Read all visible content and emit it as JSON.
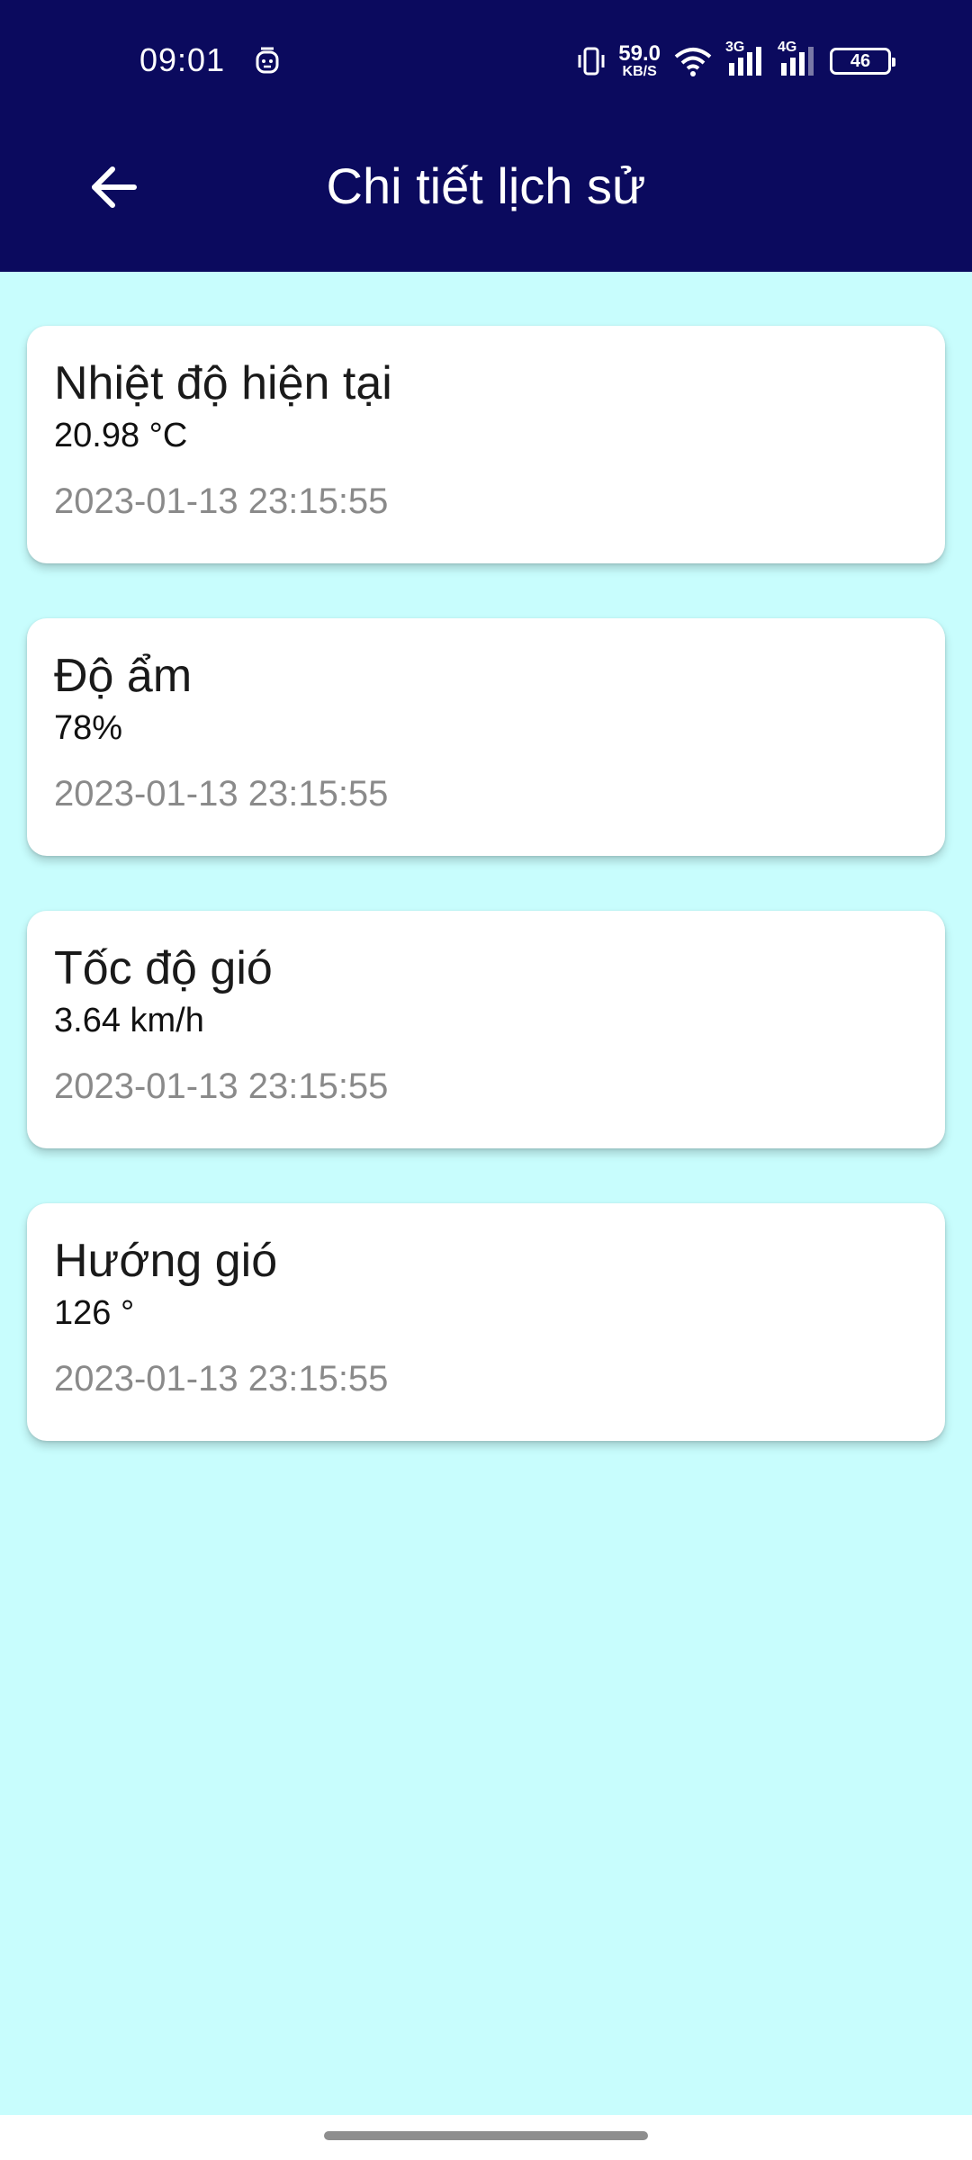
{
  "status_bar": {
    "time": "09:01",
    "net_speed_value": "59.0",
    "net_speed_unit": "KB/S",
    "signal_1_label": "3G",
    "signal_2_label": "4G",
    "battery": "46",
    "icons": [
      "face-icon",
      "vibrate-icon",
      "wifi-icon",
      "signal-3g-icon",
      "signal-4g-icon",
      "battery-icon"
    ]
  },
  "toolbar": {
    "title": "Chi tiết lịch sử",
    "back_icon": "arrow-left-icon"
  },
  "colors": {
    "app_bar": "#0b0a5e",
    "background": "#c8fdfd",
    "card": "#ffffff",
    "timestamp": "#8a8a8a"
  },
  "records": [
    {
      "label": "Nhiệt độ hiện tại",
      "value": "20.98 °C",
      "time": "2023-01-13 23:15:55"
    },
    {
      "label": "Độ ẩm",
      "value": "78%",
      "time": "2023-01-13 23:15:55"
    },
    {
      "label": "Tốc độ gió",
      "value": "3.64 km/h",
      "time": "2023-01-13 23:15:55"
    },
    {
      "label": "Hướng gió",
      "value": "126 °",
      "time": "2023-01-13 23:15:55"
    }
  ]
}
